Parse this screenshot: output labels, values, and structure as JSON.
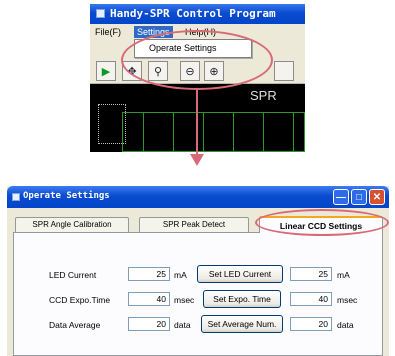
{
  "main_window": {
    "title": "Handy-SPR Control Program",
    "menus": [
      {
        "label": "File(F)"
      },
      {
        "label": "Settings"
      },
      {
        "label": "Help(H)"
      }
    ],
    "dropdown_item": "Operate Settings",
    "canvas_label": "SPR"
  },
  "dialog": {
    "title": "Operate Settings",
    "tabs": [
      {
        "label": "SPR Angle Calibration"
      },
      {
        "label": "SPR Peak Detect"
      },
      {
        "label": "Linear CCD Settings"
      }
    ],
    "selected_tab": "Linear CCD Settings",
    "rows": [
      {
        "label": "LED Current",
        "value": "25",
        "unit": "mA",
        "button": "Set LED Current",
        "set_value": "25",
        "set_unit": "mA"
      },
      {
        "label": "CCD Expo.Time",
        "value": "40",
        "unit": "msec",
        "button": "Set Expo. Time",
        "set_value": "40",
        "set_unit": "msec"
      },
      {
        "label": "Data Average",
        "value": "20",
        "unit": "data",
        "button": "Set Average Num.",
        "set_value": "20",
        "set_unit": "data"
      }
    ]
  },
  "icons": {
    "toolbar": [
      "play-icon",
      "move-icon",
      "zoom-area-icon",
      "zoom-out-icon",
      "zoom-in-icon"
    ],
    "window_controls": [
      "minimize-icon",
      "maximize-icon",
      "close-icon"
    ]
  },
  "colors": {
    "highlight": "#d86a78",
    "title_bar": "#0a4bd0",
    "menu_active": "#316ac5",
    "tab_accent": "#f5a623"
  }
}
